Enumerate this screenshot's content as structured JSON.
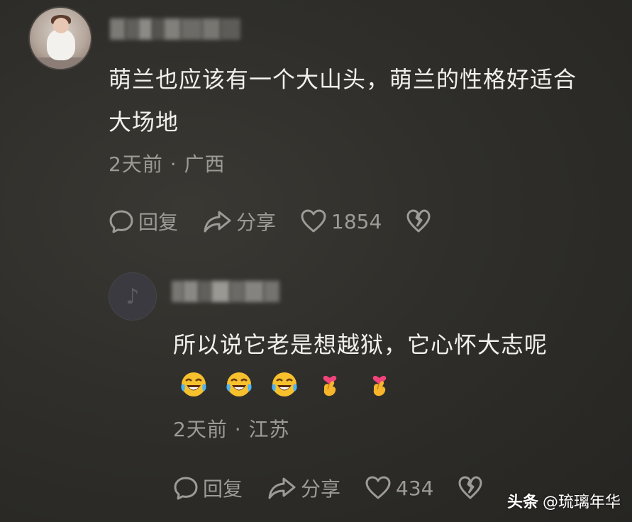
{
  "comment": {
    "text": "萌兰也应该有一个大山头，萌兰的性格好适合\n大场地",
    "meta": "2天前 · 广西",
    "actions": {
      "reply_label": "回复",
      "share_label": "分享",
      "like_count": "1854"
    }
  },
  "reply": {
    "text": "所以说它老是想越狱，它心怀大志呢",
    "emojis": [
      "laughing-crying-emoji",
      "laughing-crying-emoji",
      "laughing-crying-emoji",
      "finger-heart-emoji",
      "finger-heart-emoji"
    ],
    "meta": "2天前 · 江苏",
    "actions": {
      "reply_label": "回复",
      "share_label": "分享",
      "like_count": "434"
    }
  },
  "watermark": {
    "brand": "头条",
    "handle": "@琉璃年华"
  },
  "colors": {
    "background": "#2f2e2a",
    "text": "#f1f0ec",
    "muted": "#9d9b96"
  }
}
